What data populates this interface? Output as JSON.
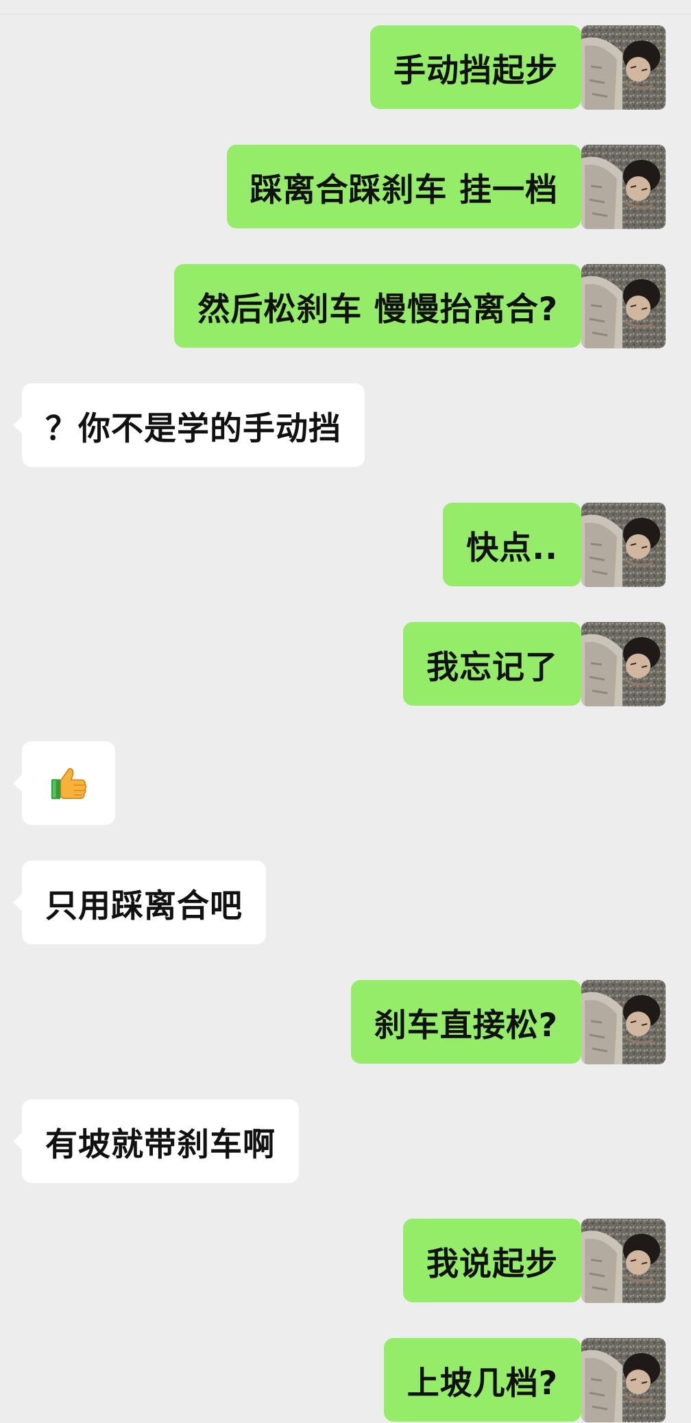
{
  "chat": {
    "messages": [
      {
        "side": "out",
        "text": "手动挡起步"
      },
      {
        "side": "out",
        "text": "踩离合踩刹车 挂一档"
      },
      {
        "side": "out",
        "text": "然后松刹车 慢慢抬离合?"
      },
      {
        "side": "in",
        "text": "？你不是学的手动挡"
      },
      {
        "side": "out",
        "text": "快点.."
      },
      {
        "side": "out",
        "text": "我忘记了"
      },
      {
        "side": "in",
        "icon": "thumbs-up-icon"
      },
      {
        "side": "in",
        "text": "只用踩离合吧"
      },
      {
        "side": "out",
        "text": "刹车直接松?"
      },
      {
        "side": "in",
        "text": "有坡就带刹车啊"
      },
      {
        "side": "out",
        "text": "我说起步"
      },
      {
        "side": "out",
        "text": "上坡几档?"
      }
    ]
  },
  "colors": {
    "background": "#ededed",
    "outgoing_bubble": "#95ec69",
    "incoming_bubble": "#ffffff"
  }
}
